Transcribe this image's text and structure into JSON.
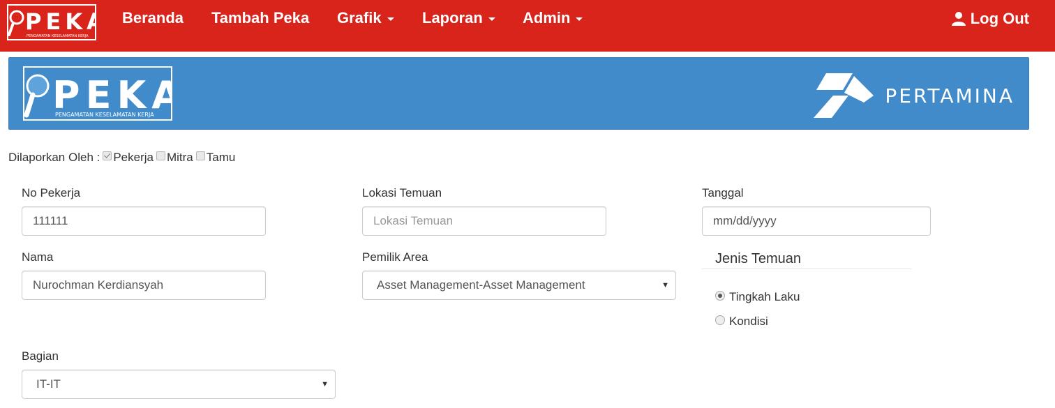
{
  "navbar": {
    "brand": {
      "text": "PEKA",
      "subtitle": "PENGAMATAN KESELAMATAN KERJA"
    },
    "items": [
      {
        "label": "Beranda",
        "dropdown": false
      },
      {
        "label": "Tambah Peka",
        "dropdown": false
      },
      {
        "label": "Grafik",
        "dropdown": true
      },
      {
        "label": "Laporan",
        "dropdown": true
      },
      {
        "label": "Admin",
        "dropdown": true
      }
    ],
    "logout_label": "Log Out",
    "color": "#d9241c"
  },
  "banner": {
    "logo_text": "PEKA",
    "logo_subtitle": "PENGAMATAN KESELAMATAN KERJA",
    "company": "PERTAMINA",
    "color": "#428bca"
  },
  "reported_by": {
    "label": "Dilaporkan Oleh :",
    "options": [
      {
        "label": "Pekerja",
        "checked": true
      },
      {
        "label": "Mitra",
        "checked": false
      },
      {
        "label": "Tamu",
        "checked": false
      }
    ]
  },
  "form": {
    "no_pekerja": {
      "label": "No Pekerja",
      "value": "111111"
    },
    "nama": {
      "label": "Nama",
      "value": "Nurochman Kerdiansyah"
    },
    "bagian": {
      "label": "Bagian",
      "value": "IT-IT"
    },
    "lokasi_temuan": {
      "label": "Lokasi Temuan",
      "value": "",
      "placeholder": "Lokasi Temuan"
    },
    "pemilik_area": {
      "label": "Pemilik Area",
      "value": "Asset Management-Asset Management"
    },
    "tanggal": {
      "label": "Tanggal",
      "value": "mm/dd/yyyy"
    },
    "jenis_temuan": {
      "legend": "Jenis Temuan",
      "options": [
        {
          "label": "Tingkah Laku",
          "checked": true
        },
        {
          "label": "Kondisi",
          "checked": false
        }
      ]
    }
  }
}
